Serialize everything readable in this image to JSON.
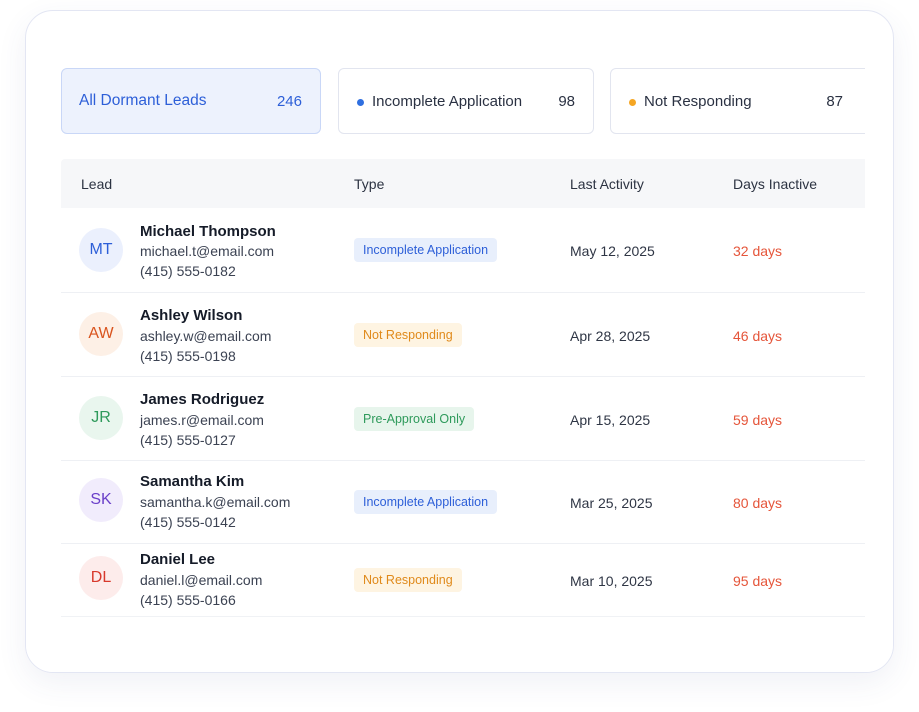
{
  "segments": [
    {
      "label": "All Dormant Leads",
      "count": "246",
      "active": true,
      "dot_color": null
    },
    {
      "label": "Incomplete Application",
      "count": "98",
      "active": false,
      "dot_color": "#2f6fe0"
    },
    {
      "label": "Not Responding",
      "count": "87",
      "active": false,
      "dot_color": "#f5a623"
    }
  ],
  "table": {
    "headers": [
      "Lead",
      "Type",
      "Last Activity",
      "Days Inactive"
    ],
    "rows": [
      {
        "initials": "MT",
        "name": "Michael Thompson",
        "email": "michael.t@email.com",
        "phone": "(415) 555-0182",
        "type": "Incomplete Application",
        "last_activity": "May 12, 2025",
        "days_inactive": "32 days"
      },
      {
        "initials": "AW",
        "name": "Ashley Wilson",
        "email": "ashley.w@email.com",
        "phone": "(415) 555-0198",
        "type": "Not Responding",
        "last_activity": "Apr 28, 2025",
        "days_inactive": "46 days"
      },
      {
        "initials": "JR",
        "name": "James Rodriguez",
        "email": "james.r@email.com",
        "phone": "(415) 555-0127",
        "type": "Pre-Approval Only",
        "last_activity": "Apr 15, 2025",
        "days_inactive": "59 days"
      },
      {
        "initials": "SK",
        "name": "Samantha Kim",
        "email": "samantha.k@email.com",
        "phone": "(415) 555-0142",
        "type": "Incomplete Application",
        "last_activity": "Mar 25, 2025",
        "days_inactive": "80 days"
      },
      {
        "initials": "DL",
        "name": "Daniel Lee",
        "email": "daniel.l@email.com",
        "phone": "(415) 555-0166",
        "type": "Not Responding",
        "last_activity": "Mar 10, 2025",
        "days_inactive": "95 days"
      }
    ]
  },
  "colors": {
    "accent": "#2d5fd8",
    "days_inactive": "#e5553a",
    "avatar_blue_bg": "#ebf0fd",
    "avatar_blue_fg": "#2d5fd8",
    "avatar_orange_bg": "#fdf0e6",
    "avatar_orange_fg": "#d9541e",
    "avatar_green_bg": "#e9f6ee",
    "avatar_green_fg": "#2e9a5b",
    "avatar_purple_bg": "#f1ecfc",
    "avatar_purple_fg": "#6a3fc9",
    "avatar_red_bg": "#fdeceb",
    "avatar_red_fg": "#d8392c"
  }
}
